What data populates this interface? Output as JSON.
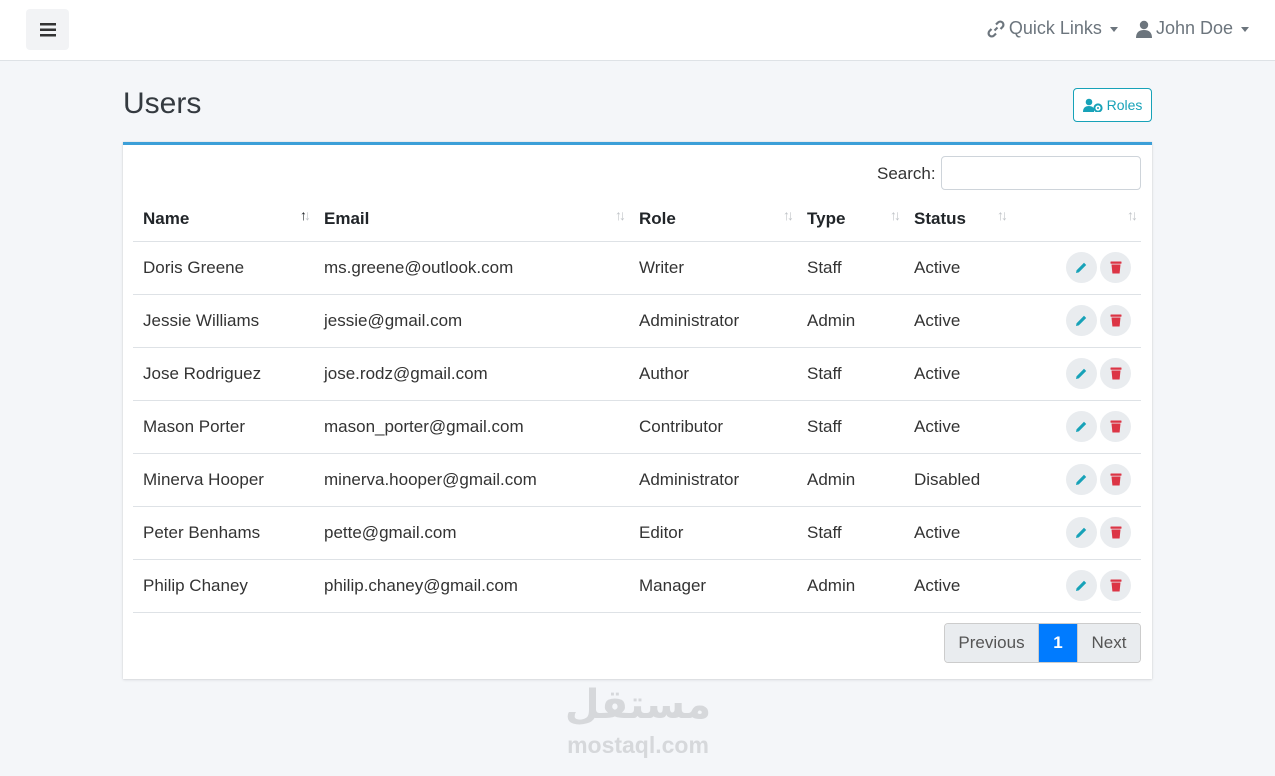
{
  "topbar": {
    "menu_icon": "hamburger-icon",
    "quick_links": "Quick Links",
    "user_name": "John Doe"
  },
  "page": {
    "title": "Users",
    "roles_button": "Roles"
  },
  "search": {
    "label": "Search:",
    "value": "",
    "placeholder": ""
  },
  "table": {
    "columns": [
      "Name",
      "Email",
      "Role",
      "Type",
      "Status"
    ],
    "rows": [
      {
        "name": "Doris Greene",
        "email": "ms.greene@outlook.com",
        "role": "Writer",
        "type": "Staff",
        "status": "Active"
      },
      {
        "name": "Jessie Williams",
        "email": "jessie@gmail.com",
        "role": "Administrator",
        "type": "Admin",
        "status": "Active"
      },
      {
        "name": "Jose Rodriguez",
        "email": "jose.rodz@gmail.com",
        "role": "Author",
        "type": "Staff",
        "status": "Active"
      },
      {
        "name": "Mason Porter",
        "email": "mason_porter@gmail.com",
        "role": "Contributor",
        "type": "Staff",
        "status": "Active"
      },
      {
        "name": "Minerva Hooper",
        "email": "minerva.hooper@gmail.com",
        "role": "Administrator",
        "type": "Admin",
        "status": "Disabled"
      },
      {
        "name": "Peter Benhams",
        "email": "pette@gmail.com",
        "role": "Editor",
        "type": "Staff",
        "status": "Active"
      },
      {
        "name": "Philip Chaney",
        "email": "philip.chaney@gmail.com",
        "role": "Manager",
        "type": "Admin",
        "status": "Active"
      }
    ]
  },
  "pagination": {
    "previous": "Previous",
    "current": "1",
    "next": "Next"
  },
  "watermark": {
    "logo": "مستقل",
    "text": "mostaql.com"
  },
  "colors": {
    "accent": "#3c9fd8",
    "edit": "#17a2b8",
    "delete": "#dc3545",
    "active_page": "#007bff"
  }
}
